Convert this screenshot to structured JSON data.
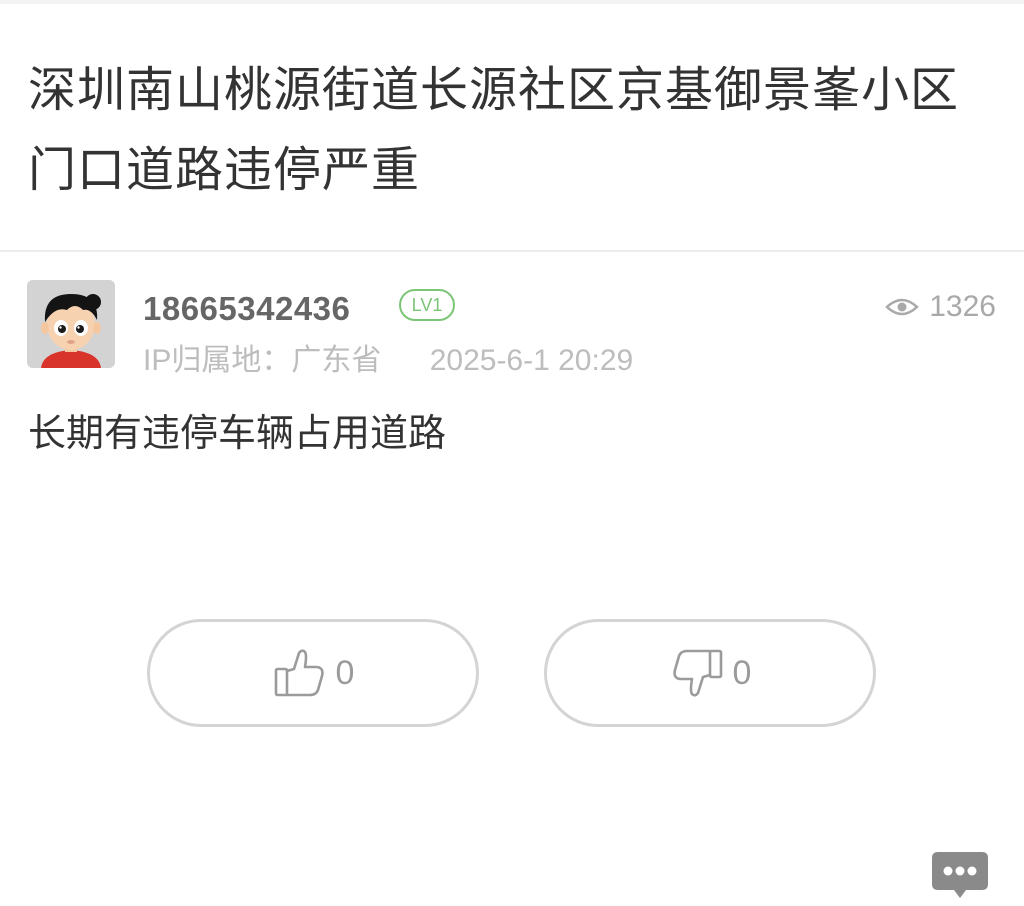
{
  "post": {
    "title": "深圳南山桃源街道长源社区京基御景峯小区门口道路违停严重",
    "content": "长期有违停车辆占用道路"
  },
  "author": {
    "username": "18665342436",
    "level": "LV1",
    "ip_location": "IP归属地：广东省",
    "timestamp": "2025-6-1 20:29",
    "avatar_icon": "cartoon-avatar-icon"
  },
  "stats": {
    "views": "1326",
    "view_icon": "eye-icon"
  },
  "actions": {
    "like_count": "0",
    "like_icon": "thumbs-up-icon",
    "dislike_count": "0",
    "dislike_icon": "thumbs-down-icon",
    "comment_icon": "comment-bubble-icon"
  },
  "colors": {
    "level_badge": "#7cc576",
    "muted_text": "#bdbdbd",
    "button_border": "#d4d4d4"
  }
}
